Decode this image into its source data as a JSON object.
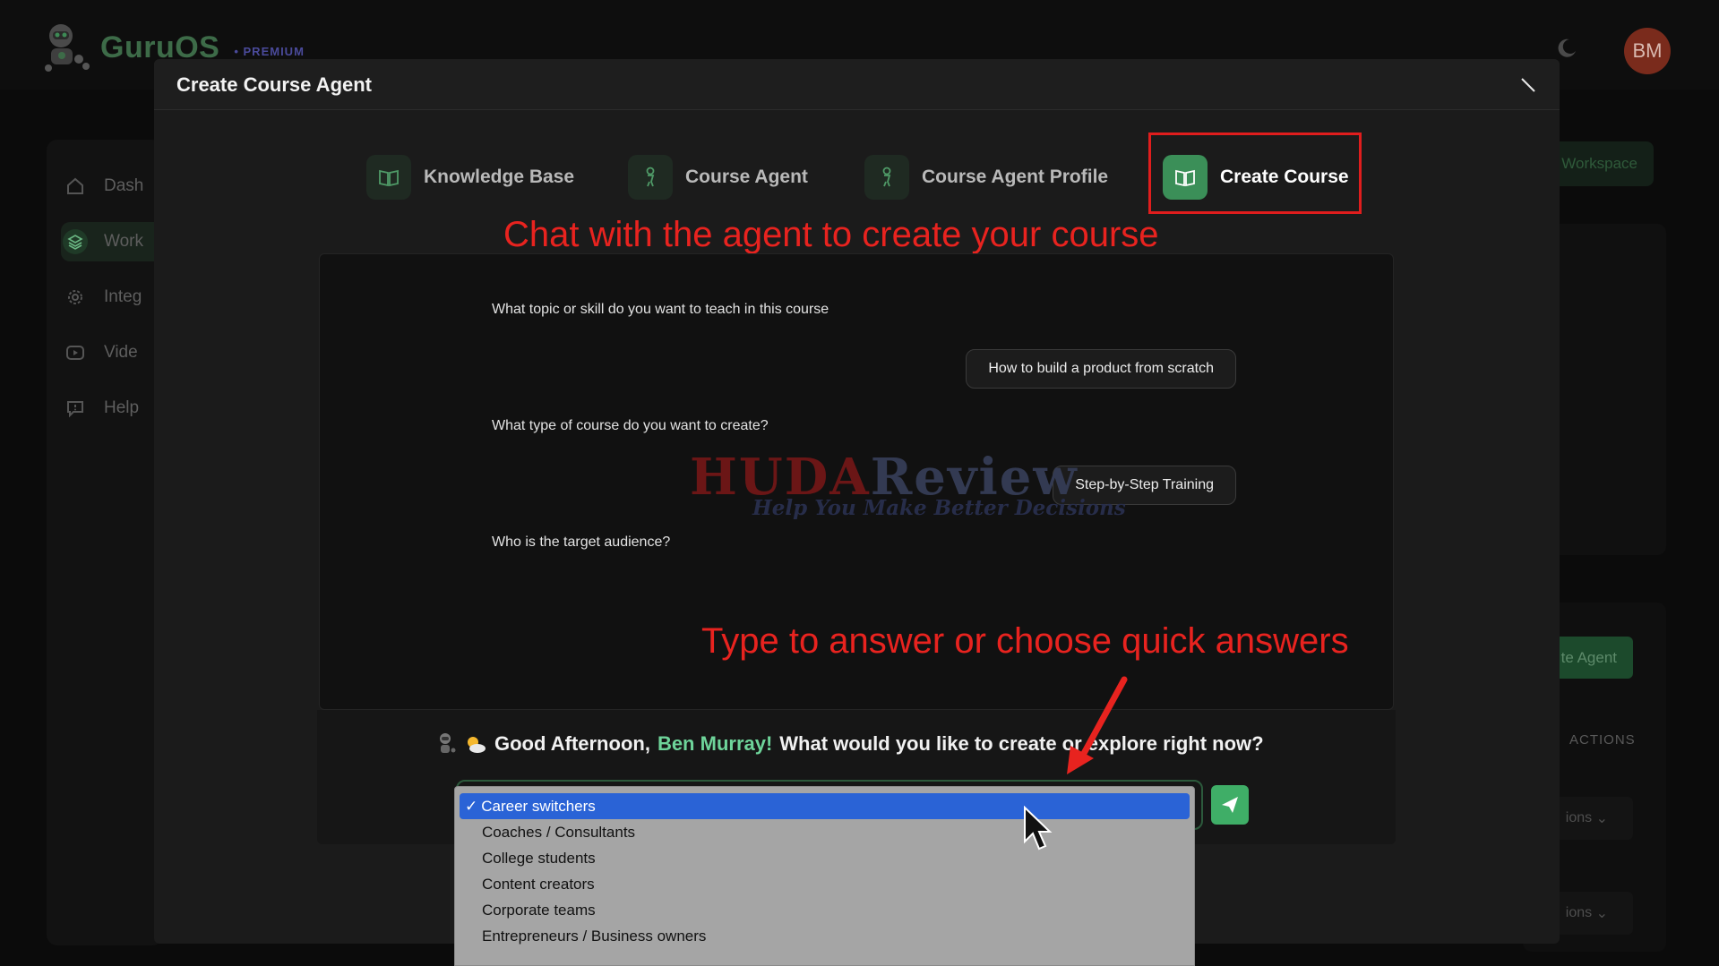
{
  "app": {
    "name": "GuruOS",
    "badge": "• PREMIUM",
    "avatar_initials": "BM"
  },
  "sidebar": {
    "items": [
      {
        "label": "Dash",
        "icon": "home-icon"
      },
      {
        "label": "Work",
        "icon": "layers-icon"
      },
      {
        "label": "Integ",
        "icon": "gear-icon"
      },
      {
        "label": "Vide",
        "icon": "video-icon"
      },
      {
        "label": "Help",
        "icon": "help-icon"
      }
    ]
  },
  "background_right": {
    "workspace_button": "Workspace",
    "agent_button": "te Agent",
    "actions_header": "ACTIONS",
    "options_1": "ions",
    "options_2": "ions"
  },
  "modal": {
    "title": "Create Course Agent",
    "steps": [
      {
        "label": "Knowledge Base",
        "icon": "book-icon"
      },
      {
        "label": "Course Agent",
        "icon": "robot-icon"
      },
      {
        "label": "Course Agent Profile",
        "icon": "robot-icon"
      },
      {
        "label": "Create Course",
        "icon": "book-icon",
        "active": true
      }
    ],
    "chat": [
      {
        "question": "What topic or skill do you want to teach in this course",
        "answer": "How to build a product from scratch"
      },
      {
        "question": "What type of course do you want to create?",
        "answer": "Step-by-Step Training"
      },
      {
        "question": "Who is the target audience?"
      }
    ],
    "greeting": {
      "prefix": "Good Afternoon, ",
      "name": "Ben Murray!",
      "suffix": " What would you like to create or explore right now?"
    },
    "dropdown_options": [
      "Career switchers",
      "Coaches / Consultants",
      "College students",
      "Content creators",
      "Corporate teams",
      "Entrepreneurs / Business owners"
    ],
    "selected_option": "Career switchers",
    "selected_mark": "✓"
  },
  "annotations": {
    "top": "Chat with the agent to create your course",
    "bottom": "Type to answer or choose quick answers"
  },
  "watermark": {
    "brand_a": "HUDA",
    "brand_b": "Review",
    "tagline": "Help You Make Better Decisions"
  },
  "colors": {
    "accent_green": "#3fae67",
    "annotation_red": "#e8231f",
    "selection_blue": "#2a63d6"
  }
}
